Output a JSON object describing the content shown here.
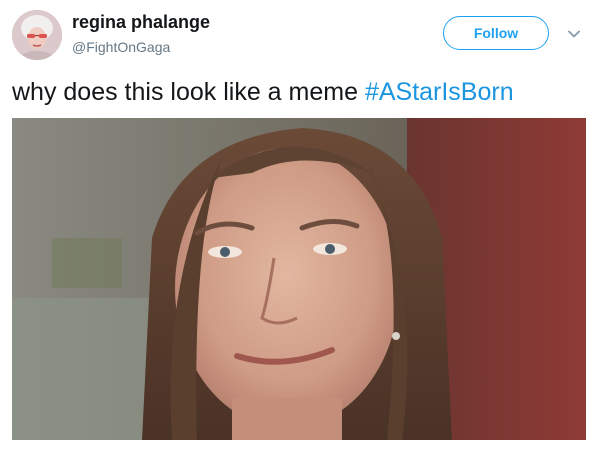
{
  "tweet": {
    "display_name": "regina phalange",
    "handle": "@FightOnGaga",
    "follow_label": "Follow",
    "text": "why does this look like a meme ",
    "hashtag": "#AStarIsBorn",
    "avatar_icon": "profile-avatar",
    "caret_icon": "chevron-down-icon",
    "media_icon": "photo-woman-face"
  },
  "colors": {
    "brand_blue": "#1da1f2",
    "hashtag_blue": "#1b95e0",
    "text": "#14171a",
    "secondary_text": "#657786"
  }
}
